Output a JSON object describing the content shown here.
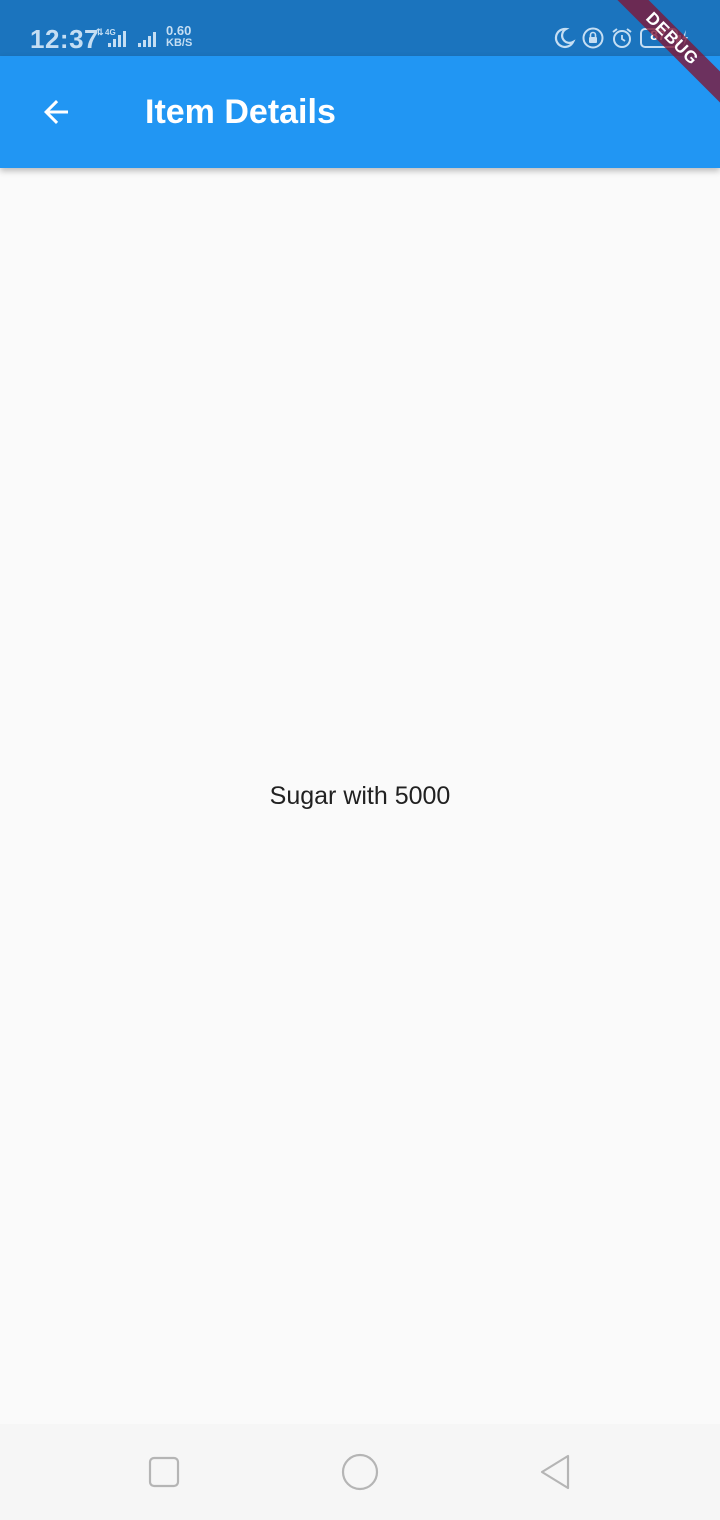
{
  "status_bar": {
    "time": "12:37",
    "network_type": "4G",
    "net_speed_value": "0.60",
    "net_speed_unit": "KB/S",
    "battery": "87"
  },
  "app_bar": {
    "title": "Item Details",
    "back_icon": "arrow-back-icon"
  },
  "debug_banner": "DEBUG",
  "content": {
    "text": "Sugar with 5000"
  },
  "nav_bar": {
    "recents_icon": "square-icon",
    "home_icon": "circle-icon",
    "back_icon": "triangle-back-icon"
  },
  "colors": {
    "status_bar": "#1b74be",
    "app_bar": "#2196f3",
    "background": "#fafafa",
    "nav_bar": "#f6f6f6"
  }
}
